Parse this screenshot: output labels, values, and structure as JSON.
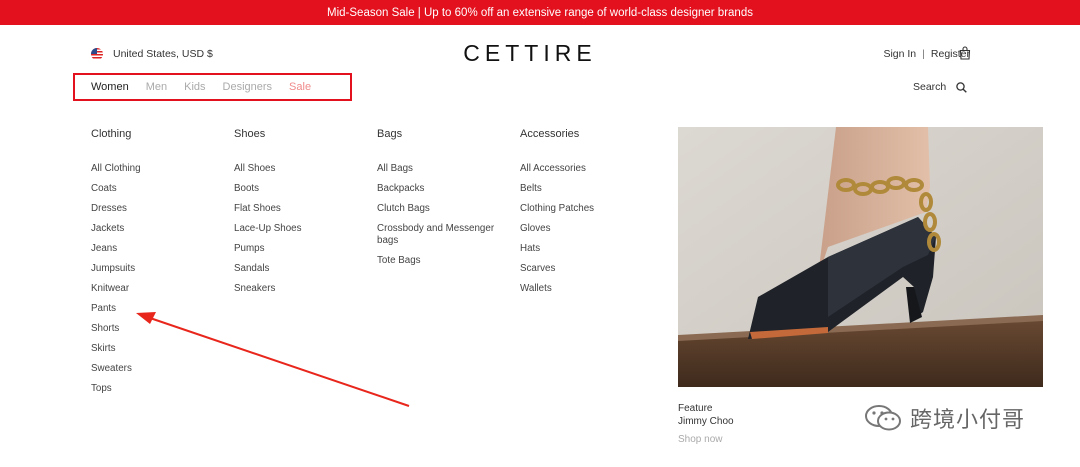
{
  "promo_banner": "Mid-Season Sale | Up to 60% off an extensive range of world-class designer brands",
  "header": {
    "locale": "United States, USD $",
    "flag_icon": "us-flag-icon",
    "logo": "CETTIRE",
    "sign_in": "Sign In",
    "separator": "|",
    "register": "Register",
    "bag_icon": "shopping-bag-icon",
    "search_label": "Search",
    "search_icon": "search-icon"
  },
  "nav": {
    "items": [
      {
        "label": "Women",
        "state": "active"
      },
      {
        "label": "Men",
        "state": "normal"
      },
      {
        "label": "Kids",
        "state": "normal"
      },
      {
        "label": "Designers",
        "state": "normal"
      },
      {
        "label": "Sale",
        "state": "sale"
      }
    ]
  },
  "menu": {
    "columns": [
      {
        "title": "Clothing",
        "items": [
          "All Clothing",
          "Coats",
          "Dresses",
          "Jackets",
          "Jeans",
          "Jumpsuits",
          "Knitwear",
          "Pants",
          "Shorts",
          "Skirts",
          "Sweaters",
          "Tops"
        ]
      },
      {
        "title": "Shoes",
        "items": [
          "All Shoes",
          "Boots",
          "Flat Shoes",
          "Lace-Up Shoes",
          "Pumps",
          "Sandals",
          "Sneakers"
        ]
      },
      {
        "title": "Bags",
        "items": [
          "All Bags",
          "Backpacks",
          "Clutch Bags",
          "Crossbody and Messenger bags",
          "Tote Bags"
        ]
      },
      {
        "title": "Accessories",
        "items": [
          "All Accessories",
          "Belts",
          "Clothing Patches",
          "Gloves",
          "Hats",
          "Scarves",
          "Wallets"
        ]
      }
    ]
  },
  "feature": {
    "kicker": "Feature",
    "brand": "Jimmy Choo",
    "cta": "Shop now"
  },
  "watermark": {
    "icon": "wechat-icon",
    "text": "跨境小付哥"
  },
  "colors": {
    "brand_red": "#e3101e",
    "annotation_red": "#e8261c"
  }
}
